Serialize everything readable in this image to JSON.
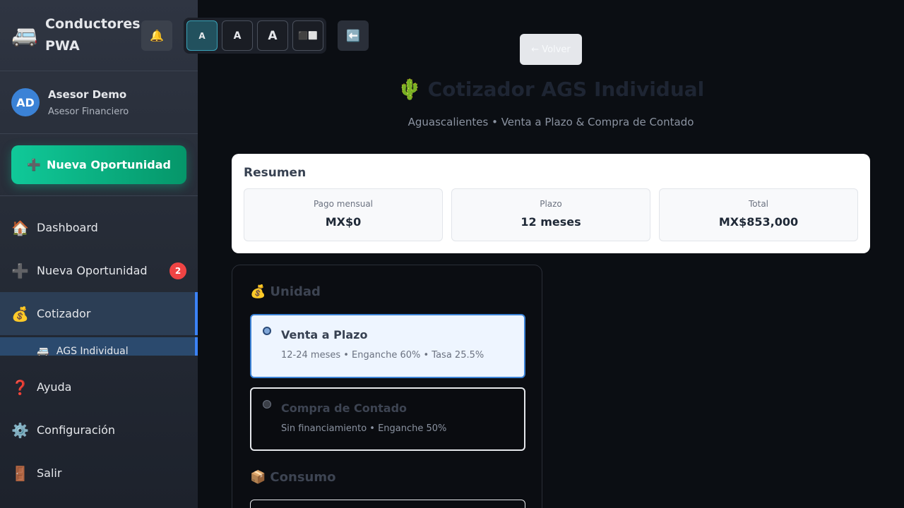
{
  "sidebar": {
    "brand_icon": "🚐",
    "brand_title": "Conductores PWA",
    "user": {
      "initials": "AD",
      "name": "Asesor Demo",
      "role": "Asesor Financiero"
    },
    "cta": {
      "icon": "➕",
      "label": "Nueva Oportunidad"
    },
    "items": [
      {
        "icon": "🏠",
        "label": "Dashboard"
      },
      {
        "icon": "➕",
        "label": "Nueva Oportunidad",
        "badge": "2"
      },
      {
        "icon": "💰",
        "label": "Cotizador"
      }
    ],
    "sub_item": {
      "icon": "🚐",
      "label": "AGS Individual"
    },
    "bottom_items": [
      {
        "icon": "❓",
        "label": "Ayuda"
      },
      {
        "icon": "⚙️",
        "label": "Configuración"
      },
      {
        "icon": "🚪",
        "label": "Salir"
      }
    ]
  },
  "toolbar": {
    "bell": "🔔",
    "font_sizes": [
      "A",
      "A",
      "A"
    ],
    "contrast": "⬛⬜",
    "back": "⬅️"
  },
  "main": {
    "volver": "← Volver",
    "title_icon": "🌵",
    "title": "Cotizador AGS Individual",
    "subtitle": "Aguascalientes • Venta a Plazo & Compra de Contado",
    "summary": {
      "title": "Resumen",
      "stats": [
        {
          "label": "Pago mensual",
          "value": "MX$0"
        },
        {
          "label": "Plazo",
          "value": "12 meses"
        },
        {
          "label": "Total",
          "value": "MX$853,000"
        }
      ]
    },
    "unidad": {
      "icon": "💰",
      "title": "Unidad",
      "options": [
        {
          "title": "Venta a Plazo",
          "desc": "12-24 meses • Enganche 60% • Tasa 25.5%",
          "selected": true
        },
        {
          "title": "Compra de Contado",
          "desc": "Sin financiamiento • Enganche 50%",
          "selected": false
        }
      ]
    },
    "consumo": {
      "icon": "📦",
      "title": "Consumo"
    }
  },
  "colors": {
    "accent": "#3b82f6",
    "cta": "#10c999",
    "badge": "#ef4444"
  }
}
